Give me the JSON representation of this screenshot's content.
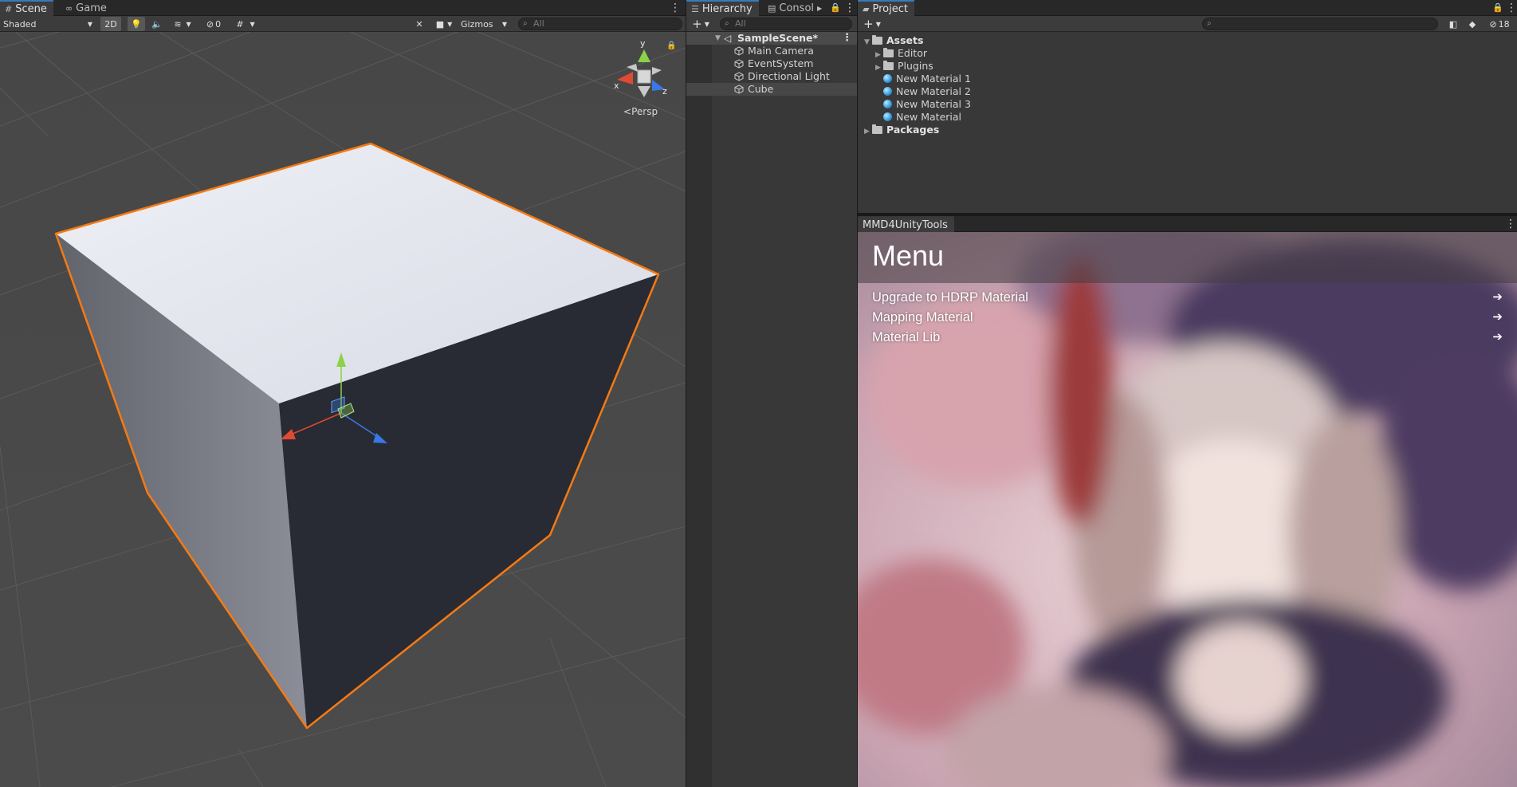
{
  "scene_panel": {
    "tabs": [
      {
        "label": "Scene",
        "icon": "grid-icon"
      },
      {
        "label": "Game",
        "icon": "gamepad-icon"
      }
    ],
    "toolbar": {
      "draw_mode": "Shaded",
      "mode_2d": "2D",
      "hidden_count": "0",
      "gizmos": "Gizmos",
      "search_placeholder": "All"
    },
    "orientation_gizmo": {
      "y": "y",
      "x": "x",
      "z": "z",
      "projection": "Persp"
    }
  },
  "hierarchy": {
    "tabs": [
      {
        "label": "Hierarchy",
        "icon": "list-icon"
      },
      {
        "label": "Consol",
        "icon": "console-icon"
      }
    ],
    "search_placeholder": "All",
    "scene": "SampleScene*",
    "items": [
      "Main Camera",
      "EventSystem",
      "Directional Light",
      "Cube"
    ],
    "selected": "Cube"
  },
  "project": {
    "tab": "Project",
    "hidden_count": "18",
    "tree": {
      "assets": "Assets",
      "children": [
        {
          "label": "Editor",
          "type": "folder"
        },
        {
          "label": "Plugins",
          "type": "folder"
        },
        {
          "label": "New Material 1",
          "type": "material"
        },
        {
          "label": "New Material 2",
          "type": "material"
        },
        {
          "label": "New Material 3",
          "type": "material"
        },
        {
          "label": "New Material",
          "type": "material"
        }
      ],
      "packages": "Packages"
    }
  },
  "mmd_tools": {
    "tab": "MMD4UnityTools",
    "title": "Menu",
    "items": [
      {
        "label": "Upgrade to HDRP Material"
      },
      {
        "label": "Mapping Material"
      },
      {
        "label": "Material Lib"
      }
    ]
  },
  "colors": {
    "selection_outline": "#f57a14",
    "active_tab_accent": "#3a79bb",
    "axis_x": "#e04a33",
    "axis_y": "#8cd147",
    "axis_z": "#3a78e8"
  }
}
